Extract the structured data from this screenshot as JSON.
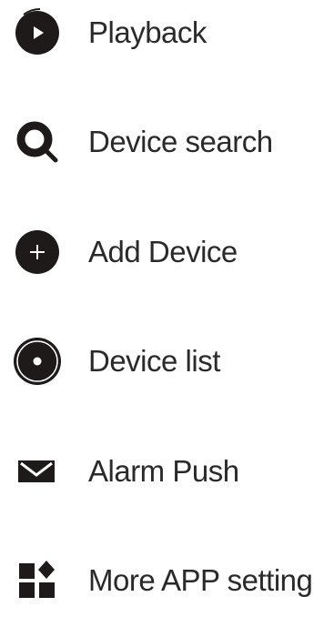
{
  "menu": {
    "items": [
      {
        "label": "Playback",
        "icon": "playback-icon"
      },
      {
        "label": "Device search",
        "icon": "search-icon"
      },
      {
        "label": "Add Device",
        "icon": "plus-circle-icon"
      },
      {
        "label": "Device list",
        "icon": "device-list-icon"
      },
      {
        "label": "Alarm Push",
        "icon": "envelope-icon"
      },
      {
        "label": "More APP setting",
        "icon": "apps-grid-icon"
      }
    ]
  },
  "colors": {
    "icon": "#1e1a1a",
    "text": "#2a2a2a",
    "background": "#ffffff"
  }
}
